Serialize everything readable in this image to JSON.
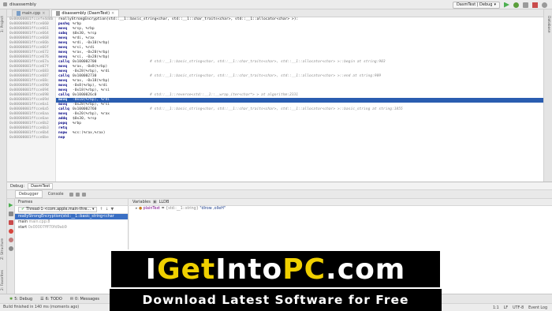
{
  "window": {
    "title": "disassembly"
  },
  "toolbar": {
    "run_config": "DasmTest | Debug"
  },
  "tabs": [
    {
      "label": "main.cpp"
    },
    {
      "label": "disassembly (DasmTest)"
    }
  ],
  "side_panels": {
    "project": "1: Project",
    "database": "Database",
    "structure": "Z: Structure",
    "favorites": "2: Favorites"
  },
  "editor": {
    "function_header": "reallyStrongEncryption(std::__1::basic_string<char, std::__1::char_traits<char>, std::__1::allocator<char> >):",
    "addresses": [
      "0x00000001fccefe4ddb",
      "0x00000001ffcce660",
      "0x00000001ffcce661",
      "0x00000001ffcce664",
      "0x00000001ffcce668",
      "0x00000001ffcce66b",
      "0x00000001ffcce66f",
      "0x00000001ffcce672",
      "0x00000001ffcce676",
      "0x00000001ffcce67a",
      "0x00000001ffcce67f",
      "0x00000001ffcce683",
      "0x00000001ffcce687",
      "0x00000001ffcce68c",
      "0x00000001ffcce690",
      "0x00000001ffcce694",
      "0x00000001ffcce698",
      "0x00000001ffcce69d",
      "0x00000001ffcce6a1",
      "0x00000001ffcce6a5",
      "0x00000001ffcce6aa",
      "0x00000001ffcce6ae",
      "0x00000001ffcce6b2",
      "0x00000001ffcce6b3",
      "0x00000001ffcce6b4",
      "0x00000001ffcce6be"
    ],
    "lines": [
      {
        "m": "pushq",
        "o": "%rbp",
        "c": ""
      },
      {
        "m": "movq",
        "o": "%rsp, %rbp",
        "c": ""
      },
      {
        "m": "subq",
        "o": "$0x30, %rsp",
        "c": ""
      },
      {
        "m": "movq",
        "o": "%rdi, %rax",
        "c": ""
      },
      {
        "m": "movq",
        "o": "%rdi, -0x10(%rbp)",
        "c": ""
      },
      {
        "m": "movq",
        "o": "%rsi, %rdi",
        "c": ""
      },
      {
        "m": "movq",
        "o": "%rax, -0x20(%rbp)",
        "c": ""
      },
      {
        "m": "movq",
        "o": "%rsi, -0x28(%rbp)",
        "c": ""
      },
      {
        "m": "callq",
        "o": "0x100002700",
        "c": "# std::__1::basic_string<char, std::__1::char_traits<char>, std::__1::allocator<char> >::begin at string:903"
      },
      {
        "m": "movq",
        "o": "%rax, -0x8(%rbp)",
        "c": ""
      },
      {
        "m": "movq",
        "o": "-0x28(%rbp), %rdi",
        "c": ""
      },
      {
        "m": "callq",
        "o": "0x100002730",
        "c": "# std::__1::basic_string<char, std::__1::char_traits<char>, std::__1::allocator<char> >::end at string:909"
      },
      {
        "m": "movq",
        "o": "%rax, -0x18(%rbp)",
        "c": ""
      },
      {
        "m": "movq",
        "o": "-0x8(%rbp), %rdi",
        "c": ""
      },
      {
        "m": "movq",
        "o": "-0x18(%rbp), %rsi",
        "c": ""
      },
      {
        "m": "callq",
        "o": "0x1000026c0",
        "c": "# std::__1::reverse<std::__1::__wrap_iter<char*> > at algorithm:2331"
      },
      {
        "m": "movq",
        "o": "-0x10(%rbp), %rdi",
        "c": ""
      },
      {
        "m": "movq",
        "o": "-0x28(%rbp), %rsi",
        "c": ""
      },
      {
        "m": "callq",
        "o": "0x100002760",
        "c": "# std::__1::basic_string<char, std::__1::char_traits<char>, std::__1::allocator<char> >::basic_string at string:1855"
      },
      {
        "m": "movq",
        "o": "-0x20(%rbp), %rax",
        "c": ""
      },
      {
        "m": "addq",
        "o": "$0x30, %rsp",
        "c": ""
      },
      {
        "m": "popq",
        "o": "%rbp",
        "c": ""
      },
      {
        "m": "retq",
        "o": "",
        "c": ""
      },
      {
        "m": "nopw",
        "o": "%cs:(%rax,%rax)",
        "c": ""
      },
      {
        "m": "nop",
        "o": "",
        "c": ""
      }
    ],
    "highlighted_line": 16
  },
  "debug": {
    "label": "Debug:",
    "config": "DasmTest",
    "tabs": {
      "debugger": "Debugger",
      "console": "Console",
      "lldb": "LLDB"
    },
    "frames_title": "Frames",
    "variables_title": "Variables",
    "thread": "Thread-1-<com.apple.main-thre...",
    "frames": [
      {
        "name": "reallyStrongEncryption(std::__1::basic_string<char",
        "file": ""
      },
      {
        "name": "main",
        "file": "main.cpp:8"
      },
      {
        "name": "start",
        "file": "0x00007fff70fd9ab9"
      }
    ],
    "variable": {
      "name": "plainText",
      "type": "{std::__1::string}",
      "value": "\"dlrow ,olleH\""
    }
  },
  "bottom_tools": [
    "5: Debug",
    "6: TODO",
    "0: Messages"
  ],
  "status": {
    "message": "Build finished in 140 ms (moments ago)",
    "pos": "1:1",
    "lf": "LF",
    "encoding": "UTF-8",
    "event_log": "Event Log"
  },
  "watermark": {
    "brand_segments": [
      {
        "t": "I",
        "c": "#ffffff"
      },
      {
        "t": "Get",
        "c": "#f0d000"
      },
      {
        "t": "Into",
        "c": "#ffffff"
      },
      {
        "t": "PC",
        "c": "#f0d000"
      },
      {
        "t": ".com",
        "c": "#ffffff"
      }
    ],
    "tagline": "Download Latest Software for Free"
  }
}
